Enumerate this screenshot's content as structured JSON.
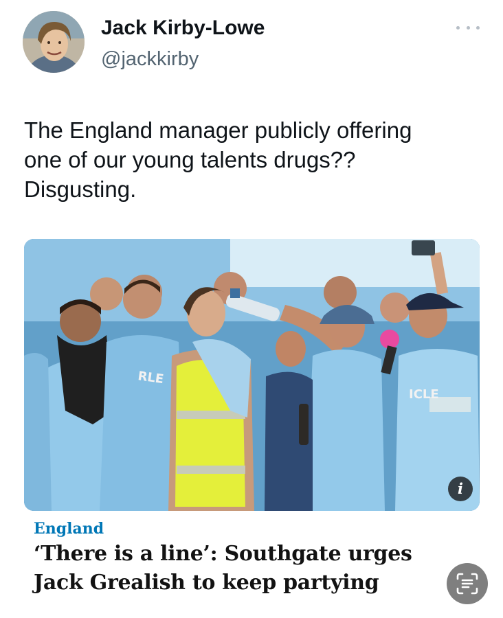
{
  "tweet": {
    "author_name": "Jack Kirby-Lowe",
    "author_handle": "@jackkirby",
    "text": "The England manager publicly offering\none of our young talents drugs??\nDisgusting.",
    "more_icon": "ellipsis-icon"
  },
  "article_card": {
    "section": "England",
    "headline": "‘There is a line’: Southgate urges\nJack Grealish to keep partying",
    "info_icon": "i"
  },
  "colors": {
    "section_accent": "#0077b6",
    "handle_gray": "#536471",
    "headline_black": "#121212",
    "jersey_sky_blue": "#8cc6ea",
    "hi_vis_yellow": "#e4ef3a"
  },
  "overlay": {
    "scan_button_icon": "text-scan-icon"
  }
}
